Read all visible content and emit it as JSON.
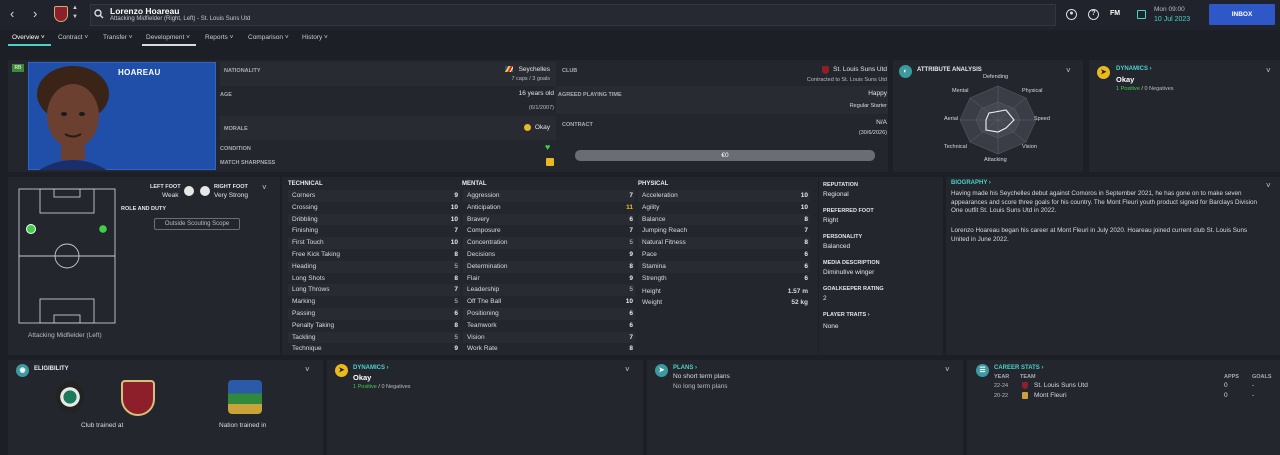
{
  "header": {
    "player_name": "Lorenzo Hoareau",
    "subtitle": "Attacking Midfielder (Right, Left) - St. Louis Suns Utd",
    "fm_label": "FM",
    "date_day": "Mon 09:00",
    "date_full": "10 Jul 2023",
    "inbox_label": "INBOX"
  },
  "tabs": [
    {
      "label": "Overview"
    },
    {
      "label": "Contract"
    },
    {
      "label": "Transfer"
    },
    {
      "label": "Development"
    },
    {
      "label": "Reports"
    },
    {
      "label": "Comparison"
    },
    {
      "label": "History"
    }
  ],
  "profile": {
    "badge": "RB",
    "surname": "HOAREAU",
    "nationality_label": "NATIONALITY",
    "nationality": "Seychelles",
    "caps": "7 caps / 3 goals",
    "age_label": "AGE",
    "age": "16 years old",
    "dob": "(6/1/2007)",
    "morale_label": "MORALE",
    "morale": "Okay",
    "condition_label": "CONDITION",
    "sharpness_label": "MATCH SHARPNESS",
    "club_label": "CLUB",
    "club": "St. Louis Suns Utd",
    "club_contract": "Contracted to St. Louis Suns Utd",
    "playing_time_label": "AGREED PLAYING TIME",
    "playing_time_status": "Happy",
    "playing_time": "Regular Starter",
    "contract_label": "CONTRACT",
    "contract_value": "N/A",
    "contract_date": "(30/6/2026)",
    "value": "€0"
  },
  "attribute_analysis": {
    "title": "ATTRIBUTE ANALYSIS",
    "axes": [
      "Defending",
      "Physical",
      "Speed",
      "Vision",
      "Attacking",
      "Technical",
      "Aerial",
      "Mental"
    ]
  },
  "dynamics_top": {
    "title": "DYNAMICS",
    "status": "Okay",
    "positives": "1 Positive",
    "sep": "/",
    "negatives": "0 Negatives"
  },
  "pitch": {
    "position_label": "Attacking Midfielder (Left)",
    "left_foot_label": "LEFT FOOT",
    "left_foot": "Weak",
    "right_foot_label": "RIGHT FOOT",
    "right_foot": "Very Strong",
    "role_label": "ROLE AND DUTY",
    "scouting_button": "Outside Scouting Scope"
  },
  "technical": {
    "title": "TECHNICAL",
    "rows": [
      {
        "name": "Corners",
        "value": "9"
      },
      {
        "name": "Crossing",
        "value": "10"
      },
      {
        "name": "Dribbling",
        "value": "10"
      },
      {
        "name": "Finishing",
        "value": "7"
      },
      {
        "name": "First Touch",
        "value": "10"
      },
      {
        "name": "Free Kick Taking",
        "value": "8"
      },
      {
        "name": "Heading",
        "value": "5"
      },
      {
        "name": "Long Shots",
        "value": "8"
      },
      {
        "name": "Long Throws",
        "value": "7"
      },
      {
        "name": "Marking",
        "value": "5"
      },
      {
        "name": "Passing",
        "value": "6"
      },
      {
        "name": "Penalty Taking",
        "value": "8"
      },
      {
        "name": "Tackling",
        "value": "5"
      },
      {
        "name": "Technique",
        "value": "9"
      }
    ]
  },
  "mental": {
    "title": "MENTAL",
    "rows": [
      {
        "name": "Aggression",
        "value": "7"
      },
      {
        "name": "Anticipation",
        "value": "11"
      },
      {
        "name": "Bravery",
        "value": "6"
      },
      {
        "name": "Composure",
        "value": "7"
      },
      {
        "name": "Concentration",
        "value": "5"
      },
      {
        "name": "Decisions",
        "value": "9"
      },
      {
        "name": "Determination",
        "value": "8"
      },
      {
        "name": "Flair",
        "value": "9"
      },
      {
        "name": "Leadership",
        "value": "5"
      },
      {
        "name": "Off The Ball",
        "value": "10"
      },
      {
        "name": "Positioning",
        "value": "6"
      },
      {
        "name": "Teamwork",
        "value": "6"
      },
      {
        "name": "Vision",
        "value": "7"
      },
      {
        "name": "Work Rate",
        "value": "8"
      }
    ]
  },
  "physical": {
    "title": "PHYSICAL",
    "rows": [
      {
        "name": "Acceleration",
        "value": "10"
      },
      {
        "name": "Agility",
        "value": "10"
      },
      {
        "name": "Balance",
        "value": "8"
      },
      {
        "name": "Jumping Reach",
        "value": "7"
      },
      {
        "name": "Natural Fitness",
        "value": "8"
      },
      {
        "name": "Pace",
        "value": "6"
      },
      {
        "name": "Stamina",
        "value": "6"
      },
      {
        "name": "Strength",
        "value": "6"
      }
    ],
    "height_label": "Height",
    "height": "1.57 m",
    "weight_label": "Weight",
    "weight": "52 kg"
  },
  "info": {
    "reputation_label": "REPUTATION",
    "reputation": "Regional",
    "preferred_foot_label": "PREFERRED FOOT",
    "preferred_foot": "Right",
    "personality_label": "PERSONALITY",
    "personality": "Balanced",
    "media_label": "MEDIA DESCRIPTION",
    "media": "Diminutive winger",
    "gk_label": "GOALKEEPER RATING",
    "gk": "2",
    "traits_label": "PLAYER TRAITS",
    "traits": "None"
  },
  "biography": {
    "title": "BIOGRAPHY",
    "para1": "Having made his Seychelles debut against Comoros in September 2021, he has gone on to make seven appearances and score three goals for his country. The Mont Fleuri youth product signed for Barclays Division One outfit St. Louis Suns Utd in 2022.",
    "para2": "Lorenzo Hoareau began his career at Mont Fleuri in July 2020. Hoareau joined current club St. Louis Suns United in June 2022."
  },
  "eligibility": {
    "title": "ELIGIBILITY",
    "club_trained": "Club trained at",
    "nation_trained": "Nation trained in"
  },
  "dynamics_bottom": {
    "title": "DYNAMICS",
    "status": "Okay",
    "positives": "1 Positive",
    "sep": "/",
    "negatives": "0 Negatives"
  },
  "plans": {
    "title": "PLANS",
    "short": "No short term plans",
    "long": "No long term plans"
  },
  "career": {
    "title": "CAREER STATS",
    "col_year": "YEAR",
    "col_team": "TEAM",
    "col_apps": "APPS",
    "col_goals": "GOALS",
    "rows": [
      {
        "year": "22-24",
        "team": "St. Louis Suns Utd",
        "apps": "0",
        "goals": "-"
      },
      {
        "year": "20-22",
        "team": "Mont Fleuri",
        "apps": "0",
        "goals": "-"
      }
    ]
  },
  "colors": {
    "accent": "#4ad2c8",
    "highlight_value": "#f0c020",
    "inbox": "#2e58c8",
    "player_bg": "#1f4fa8"
  }
}
